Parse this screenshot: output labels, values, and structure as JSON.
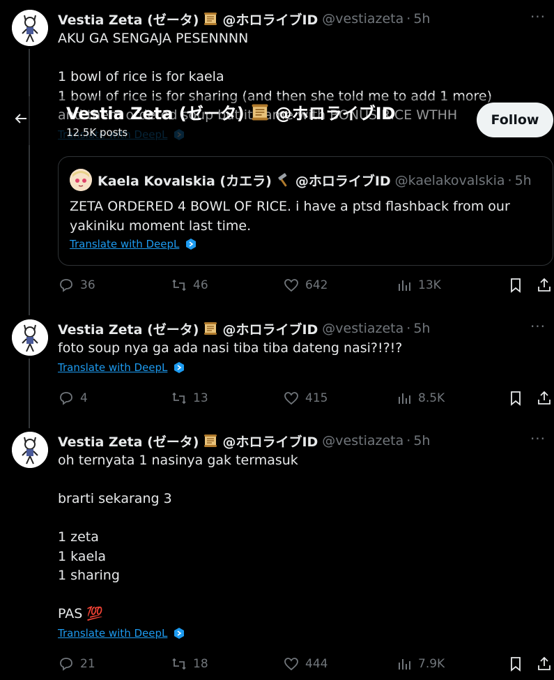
{
  "sticky_header": {
    "title": "Vestia Zeta (ゼータ)",
    "title_handle": "@ホロライブID",
    "posts_count": "12.5K posts",
    "follow_label": "Follow"
  },
  "tweets": [
    {
      "name": "Vestia Zeta (ゼータ)",
      "handle_jp": "@ホロライブID",
      "handle": "@vestiazeta",
      "time": "5h",
      "text": "AKU GA SENGAJA PESENNNN\n\n1 bowl of rice is for kaela\n1 bowl of rice is for sharing (and then she told me to add 1 more)\nand them ordered soup but it came with BONUS RICE WTHH",
      "translate": "Translate with DeepL",
      "quote": {
        "name": "Kaela Kovalskia (カエラ)",
        "handle_jp": "@ホロライブID",
        "handle": "@kaelakovalskia",
        "time": "5h",
        "text": "ZETA ORDERED 4 BOWL OF RICE. i have a ptsd flashback from our yakiniku moment last time.",
        "translate": "Translate with DeepL"
      },
      "replies": "36",
      "retweets": "46",
      "likes": "642",
      "views": "13K"
    },
    {
      "name": "Vestia Zeta (ゼータ)",
      "handle_jp": "@ホロライブID",
      "handle": "@vestiazeta",
      "time": "5h",
      "text": "foto soup nya ga ada nasi tiba tiba dateng nasi?!?!?",
      "translate": "Translate with DeepL",
      "replies": "4",
      "retweets": "13",
      "likes": "415",
      "views": "8.5K"
    },
    {
      "name": "Vestia Zeta (ゼータ)",
      "handle_jp": "@ホロライブID",
      "handle": "@vestiazeta",
      "time": "5h",
      "text": "oh ternyata 1 nasinya gak termasuk\n\nbrarti sekarang 3\n\n1 zeta\n1 kaela\n1 sharing\n\nPAS 💯",
      "translate": "Translate with DeepL",
      "replies": "21",
      "retweets": "18",
      "likes": "444",
      "views": "7.9K"
    }
  ],
  "colors": {
    "background": "#000000",
    "text": "#e7e9ea",
    "muted": "#71767b",
    "link": "#1d9bf0",
    "border": "#2f3336"
  }
}
